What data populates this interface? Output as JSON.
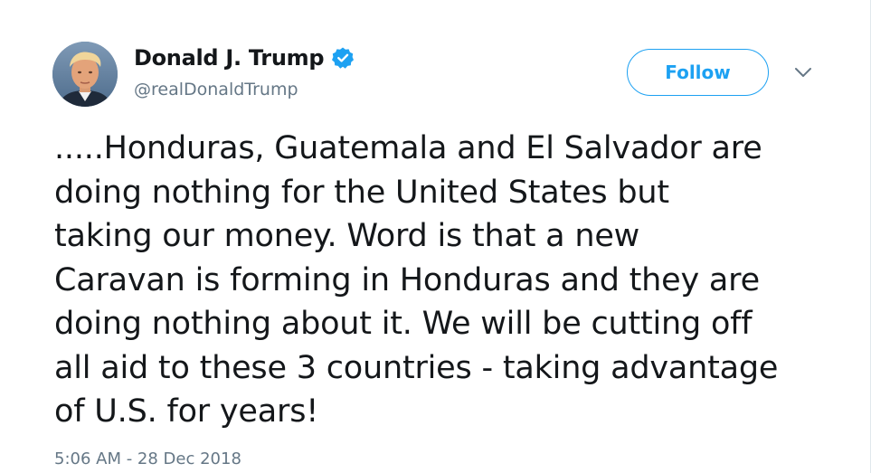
{
  "author": {
    "display_name": "Donald J. Trump",
    "handle": "@realDonaldTrump",
    "verified": true,
    "avatar_icon": "profile-photo"
  },
  "actions": {
    "follow_label": "Follow",
    "menu_icon": "chevron-down-icon"
  },
  "tweet": {
    "lines": [
      ".....Honduras, Guatemala and El Salvador are",
      "doing nothing for the United States but",
      "taking our money. Word is that a new",
      "Caravan is forming in Honduras and they are",
      "doing nothing about it. We will be cutting off",
      "all aid to these 3 countries - taking advantage",
      "of U.S. for years!"
    ],
    "timestamp": "5:06 AM - 28 Dec 2018"
  },
  "colors": {
    "accent": "#1da1f2",
    "text": "#14171a",
    "secondary_text": "#657786",
    "background": "#ffffff"
  }
}
